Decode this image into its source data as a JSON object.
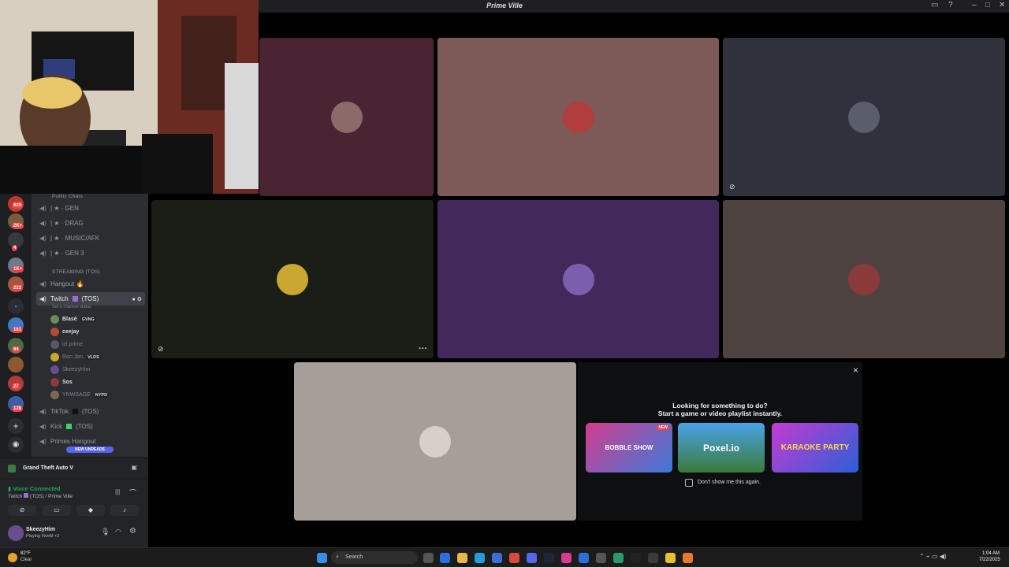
{
  "window": {
    "title": "Prime Ville"
  },
  "channels": {
    "category_public": "Public Chats",
    "voice_channels": [
      {
        "name": "| ★ · GEN"
      },
      {
        "name": "| ★ · DRAG"
      },
      {
        "name": "| ★ · MUSIC/AFK"
      },
      {
        "name": "| ★ · GEN 3"
      }
    ],
    "category_streaming": "STREAMING (TOS)",
    "hangout": "Hangout 🔥",
    "twitch": {
      "name": "Twitch",
      "suffix": "(TOS)",
      "status": "Set a channel status"
    },
    "members": [
      {
        "name": "Blasé",
        "tag": "GVNG"
      },
      {
        "name": "ceejay",
        "tag": ""
      },
      {
        "name": "izi prime",
        "tag": ""
      },
      {
        "name": "Ron Jon",
        "tag": "VLDS"
      },
      {
        "name": "SkeezyHim",
        "tag": ""
      },
      {
        "name": "Sos",
        "tag": ""
      },
      {
        "name": "YNWSAGE",
        "tag": "NYPD"
      }
    ],
    "tiktok": {
      "name": "TikTok",
      "suffix": "(TOS)"
    },
    "kick": {
      "name": "Kick",
      "suffix": "(TOS)"
    },
    "primes_hangout": "Primes Hangout",
    "new_unreads": "NEW UNREADS"
  },
  "rail": {
    "badges": [
      "629",
      "2K+",
      "4",
      "1K+",
      "222",
      "161",
      "64",
      "27",
      "128"
    ]
  },
  "activity": {
    "game": "Grand Theft Auto V"
  },
  "voice": {
    "status": "Voice Connected",
    "channel": "Twitch",
    "channel_suffix": "(TOS) / Prime Ville"
  },
  "user": {
    "name": "SkeezyHim",
    "status": "Playing FiveM +2"
  },
  "stage": {
    "tile_colors": [
      "#4a2433",
      "#7d5a58",
      "#2f323d",
      "#1b1d17",
      "#43295b",
      "#4e4241",
      "#a69e98"
    ]
  },
  "activities": {
    "line1": "Looking for something to do?",
    "line2": "Start a game or video playlist instantly.",
    "cards": [
      {
        "label": "NEW",
        "name": "BOBBLE SHOW"
      },
      {
        "label": "",
        "name": "Poxel.io"
      },
      {
        "label": "",
        "name": "KARAOKE PARTY"
      }
    ],
    "checkbox": "Don't show me this again.",
    "close": "×"
  },
  "taskbar": {
    "weather_temp": "82°F",
    "weather_desc": "Clear",
    "search": "Search",
    "time": "1:04 AM",
    "date": "7/22/2025"
  }
}
